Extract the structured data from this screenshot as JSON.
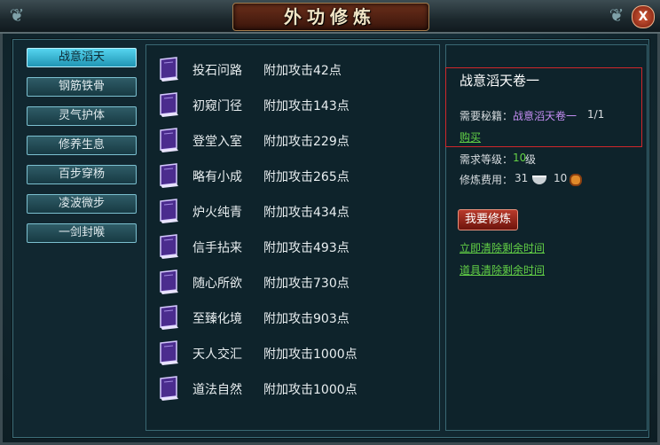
{
  "window": {
    "title": "外功修炼",
    "close_label": "X"
  },
  "skills": [
    {
      "label": "战意滔天",
      "active": true
    },
    {
      "label": "钢筋铁骨"
    },
    {
      "label": "灵气护体"
    },
    {
      "label": "修养生息"
    },
    {
      "label": "百步穿杨"
    },
    {
      "label": "凌波微步"
    },
    {
      "label": "一剑封喉"
    }
  ],
  "levels": [
    {
      "name": "投石问路",
      "bonus": "附加攻击42点",
      "icon": "book-icon"
    },
    {
      "name": "初窥门径",
      "bonus": "附加攻击143点",
      "icon": "book-icon"
    },
    {
      "name": "登堂入室",
      "bonus": "附加攻击229点",
      "icon": "book-icon"
    },
    {
      "name": "略有小成",
      "bonus": "附加攻击265点",
      "icon": "book-icon"
    },
    {
      "name": "炉火纯青",
      "bonus": "附加攻击434点",
      "icon": "book-icon"
    },
    {
      "name": "信手拈来",
      "bonus": "附加攻击493点",
      "icon": "book-icon"
    },
    {
      "name": "随心所欲",
      "bonus": "附加攻击730点",
      "icon": "book-icon"
    },
    {
      "name": "至臻化境",
      "bonus": "附加攻击903点",
      "icon": "book-icon"
    },
    {
      "name": "天人交汇",
      "bonus": "附加攻击1000点",
      "icon": "book-icon"
    },
    {
      "name": "道法自然",
      "bonus": "附加攻击1000点",
      "icon": "book-icon"
    }
  ],
  "detail": {
    "title": "战意滔天卷一",
    "req_book_label": "需要秘籍：",
    "req_book_name": "战意滔天卷一",
    "req_book_count": "1/1",
    "buy_link": "购买",
    "req_level_label": "需求等级：",
    "req_level_value": "10",
    "req_level_unit": "级",
    "cost_label": "修炼费用：",
    "cost_silver": "31",
    "cost_coin": "10",
    "train_button": "我要修炼",
    "clear_now_link": "立即清除剩余时间",
    "clear_item_link": "道具清除剩余时间"
  },
  "colors": {
    "accent_cyan": "#55d4ef",
    "highlight_red": "#d0272b",
    "link_green": "#63d146",
    "book_purple": "#c48df2"
  }
}
